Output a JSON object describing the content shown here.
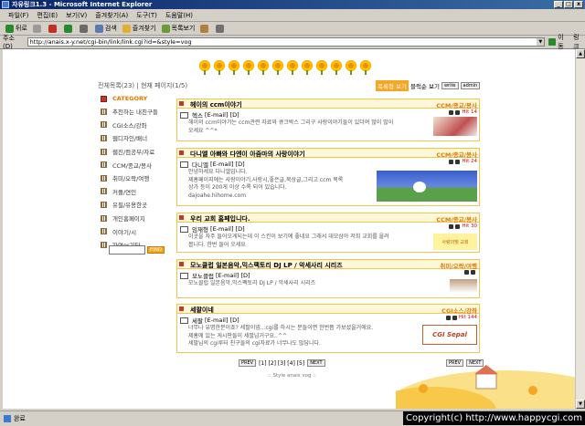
{
  "window": {
    "title": "자유링크1.3 - Microsoft Internet Explorer"
  },
  "menu": [
    "파일(F)",
    "편집(E)",
    "보기(V)",
    "즐겨찾기(A)",
    "도구(T)",
    "도움말(H)"
  ],
  "toolbar": {
    "back": "뒤로",
    "search": "검색",
    "favorites": "즐겨찾기",
    "history": "목록보기"
  },
  "address": {
    "label": "주소(D)",
    "url": "http://anais.x-y.net/cgi-bin/link/link.cgi?id=&style=vog",
    "go": "이동",
    "links": "링크"
  },
  "page": {
    "meta": "전체목록(23) | 현재 페이지(1/5)",
    "view_btn_active": "목록형 보기",
    "view_btn_text": "블럭순 보기",
    "write_btn": "write",
    "admin_btn": "admin",
    "category_head": "CATEGORY",
    "categories": [
      "추천하는 내친구들",
      "CGI소스/강좌",
      "웹디자인/배너",
      "웹진/컴공부/자료",
      "CCM/종교/봉사",
      "취미/오락/여행",
      "커플/연인",
      "유필/유용한곳",
      "개인홈페이지",
      "이야기/시",
      "자연or기타"
    ],
    "find_btn": "FIND",
    "posts": [
      {
        "title": "헤이의 ccm이야기",
        "cat": "CCM/종교/봉사",
        "author": "헥스",
        "tags": "[E-mail] [D]",
        "time": "Hit 14",
        "body": "헤이의 ccm이야기는 ccm관련 자료와 큐크박스 그리구 사랑이야기들이 있더여 많이 많이 오세요 ^^*"
      },
      {
        "title": "다니엘 아빠와 다엔이 아줌마의 사랑이야기",
        "cat": "CCM/종교/봉사",
        "author": "다니엘",
        "tags": "[E-mail] [D]",
        "time": "Hit 24",
        "body": "안녕하세요 다니엘입니다.\n제홈페이지에는 사랑이야기,사랑시,좋은글,묵상글,그리고 ccm 목록\n상가 등이 200게 이상 수록 되어 있습니다.\ndajoahe.hihome.com"
      },
      {
        "title": "우리 교회 홈페입니다.",
        "cat": "CCM/종교/봉사",
        "author": "임재형",
        "tags": "[E-mail] [D]",
        "time": "Hit 30",
        "body": "이곳을 자주 들어오게되는데 이 스킨이 보기에 좋네요 그래서 데모삼아 저희 교회를 올려\n봅니다. 한번 들어 오세요",
        "thumb": "사랑의빛 교회"
      },
      {
        "title": "모노클럽 일본음악,믹스팩토리 DJ LP / 악세사리 시리즈",
        "cat": "취미/오락/여행",
        "author": "모노클럽",
        "tags": "[E-mail] [D]",
        "time": "",
        "body": "모노클럽 일본음악,믹스팩토리 DJ LP / 악세사리 시리즈"
      },
      {
        "title": "세팔이네",
        "cat": "CGI소스/강좌",
        "author": "세팔",
        "tags": "[E-mail] [D]",
        "time": "Hit 144",
        "body": "너무나 유명한분이죠? 세팔이넵...cgi를 하시는 분들이면 한번쯤 가보셨을거에요.\n제홈에 있는 게시판들이 세팔넘거구요..^^\n세팔님의 cgi루터 친구들의 cgi자료가 너무나도 많답니다.",
        "thumb": "CGI Sepal"
      }
    ],
    "pager": {
      "prev": "PREV",
      "pages": "[1] [2] [3] [4] [5]",
      "next": "NEXT"
    },
    "style_text": ":: Style anais vog ::"
  },
  "status": {
    "text": "완료"
  },
  "copyright": "Copyright(c) http://www.happycgi.com"
}
